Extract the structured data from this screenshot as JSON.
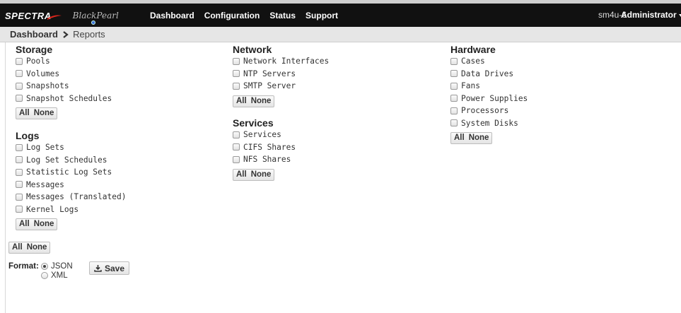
{
  "navbar": {
    "logo_primary": "SPECTRA",
    "logo_secondary": "BlackPearl",
    "links": [
      "Dashboard",
      "Configuration",
      "Status",
      "Support"
    ],
    "host": "sm4u-6",
    "user": "Administrator"
  },
  "breadcrumb": {
    "root": "Dashboard",
    "current": "Reports"
  },
  "sections": {
    "storage": {
      "title": "Storage",
      "items": [
        "Pools",
        "Volumes",
        "Snapshots",
        "Snapshot Schedules"
      ]
    },
    "logs": {
      "title": "Logs",
      "items": [
        "Log Sets",
        "Log Set Schedules",
        "Statistic Log Sets",
        "Messages",
        "Messages (Translated)",
        "Kernel Logs"
      ]
    },
    "network": {
      "title": "Network",
      "items": [
        "Network Interfaces",
        "NTP Servers",
        "SMTP Server"
      ]
    },
    "services": {
      "title": "Services",
      "items": [
        "Services",
        "CIFS Shares",
        "NFS Shares"
      ]
    },
    "hardware": {
      "title": "Hardware",
      "items": [
        "Cases",
        "Data Drives",
        "Fans",
        "Power Supplies",
        "Processors",
        "System Disks"
      ]
    }
  },
  "buttons": {
    "all": "All",
    "none": "None",
    "save": "Save"
  },
  "format": {
    "label": "Format:",
    "options": [
      "JSON",
      "XML"
    ],
    "selected": "JSON"
  },
  "colors": {
    "navbar": "#111111",
    "breadcrumb_bg": "#e6e6e6"
  }
}
